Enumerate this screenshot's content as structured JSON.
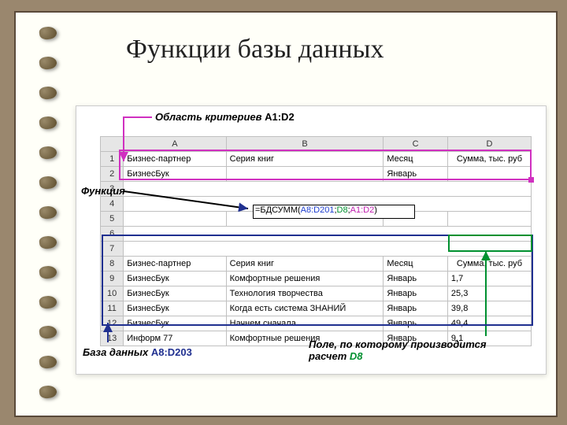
{
  "title": "Функции базы данных",
  "captions": {
    "criteria": "Область критериев",
    "criteria_ref": "A1:D2",
    "function": "Функция",
    "database": "База данных",
    "database_ref": "A8:D203",
    "field": "Поле, по которому производится расчет",
    "field_ref": "D8"
  },
  "columns": {
    "a": "A",
    "b": "B",
    "c": "C",
    "d": "D"
  },
  "headers": {
    "partner": "Бизнес-партнер",
    "series": "Серия книг",
    "month": "Месяц",
    "sum": "Сумма, тыс. руб"
  },
  "criteria_row": {
    "partner": "БизнесБук",
    "month": "Январь"
  },
  "formula": {
    "fn": "=БДСУММ(",
    "r1": "A8:D201",
    "r2": "D8",
    "r3": "A1:D2",
    "close": ")"
  },
  "rows": [
    {
      "n": "8",
      "partner": "Бизнес-партнер",
      "series": "Серия книг",
      "month": "Месяц",
      "sum": "Сумма, тыс. руб"
    },
    {
      "n": "9",
      "partner": "БизнесБук",
      "series": "Комфортные решения",
      "month": "Январь",
      "sum": "1,7"
    },
    {
      "n": "10",
      "partner": "БизнесБук",
      "series": "Технология творчества",
      "month": "Январь",
      "sum": "25,3"
    },
    {
      "n": "11",
      "partner": "БизнесБук",
      "series": "Когда есть система ЗНАНИЙ",
      "month": "Январь",
      "sum": "39,8"
    },
    {
      "n": "12",
      "partner": "БизнесБук",
      "series": "Начнем сначала",
      "month": "Январь",
      "sum": "49,4"
    },
    {
      "n": "13",
      "partner": "Информ 77",
      "series": "Комфортные решения",
      "month": "Январь",
      "sum": "9,1"
    }
  ]
}
